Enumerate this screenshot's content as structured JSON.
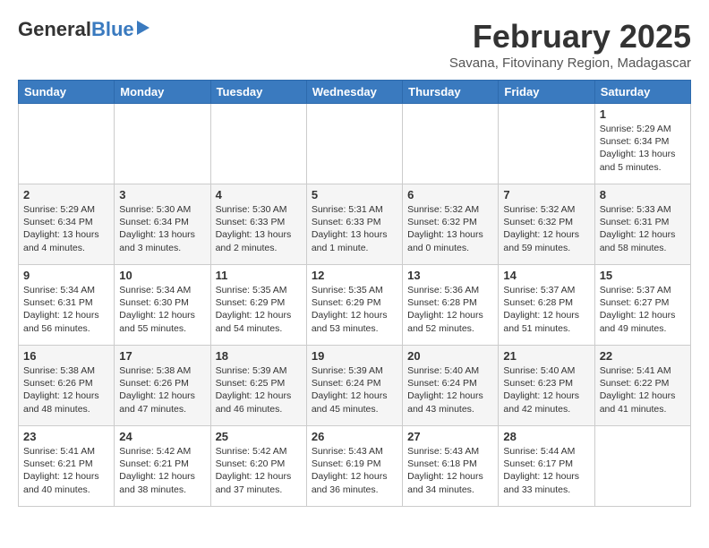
{
  "header": {
    "logo_general": "General",
    "logo_blue": "Blue",
    "month_title": "February 2025",
    "subtitle": "Savana, Fitovinany Region, Madagascar"
  },
  "weekdays": [
    "Sunday",
    "Monday",
    "Tuesday",
    "Wednesday",
    "Thursday",
    "Friday",
    "Saturday"
  ],
  "weeks": [
    [
      {
        "day": "",
        "info": ""
      },
      {
        "day": "",
        "info": ""
      },
      {
        "day": "",
        "info": ""
      },
      {
        "day": "",
        "info": ""
      },
      {
        "day": "",
        "info": ""
      },
      {
        "day": "",
        "info": ""
      },
      {
        "day": "1",
        "info": "Sunrise: 5:29 AM\nSunset: 6:34 PM\nDaylight: 13 hours\nand 5 minutes."
      }
    ],
    [
      {
        "day": "2",
        "info": "Sunrise: 5:29 AM\nSunset: 6:34 PM\nDaylight: 13 hours\nand 4 minutes."
      },
      {
        "day": "3",
        "info": "Sunrise: 5:30 AM\nSunset: 6:34 PM\nDaylight: 13 hours\nand 3 minutes."
      },
      {
        "day": "4",
        "info": "Sunrise: 5:30 AM\nSunset: 6:33 PM\nDaylight: 13 hours\nand 2 minutes."
      },
      {
        "day": "5",
        "info": "Sunrise: 5:31 AM\nSunset: 6:33 PM\nDaylight: 13 hours\nand 1 minute."
      },
      {
        "day": "6",
        "info": "Sunrise: 5:32 AM\nSunset: 6:32 PM\nDaylight: 13 hours\nand 0 minutes."
      },
      {
        "day": "7",
        "info": "Sunrise: 5:32 AM\nSunset: 6:32 PM\nDaylight: 12 hours\nand 59 minutes."
      },
      {
        "day": "8",
        "info": "Sunrise: 5:33 AM\nSunset: 6:31 PM\nDaylight: 12 hours\nand 58 minutes."
      }
    ],
    [
      {
        "day": "9",
        "info": "Sunrise: 5:34 AM\nSunset: 6:31 PM\nDaylight: 12 hours\nand 56 minutes."
      },
      {
        "day": "10",
        "info": "Sunrise: 5:34 AM\nSunset: 6:30 PM\nDaylight: 12 hours\nand 55 minutes."
      },
      {
        "day": "11",
        "info": "Sunrise: 5:35 AM\nSunset: 6:29 PM\nDaylight: 12 hours\nand 54 minutes."
      },
      {
        "day": "12",
        "info": "Sunrise: 5:35 AM\nSunset: 6:29 PM\nDaylight: 12 hours\nand 53 minutes."
      },
      {
        "day": "13",
        "info": "Sunrise: 5:36 AM\nSunset: 6:28 PM\nDaylight: 12 hours\nand 52 minutes."
      },
      {
        "day": "14",
        "info": "Sunrise: 5:37 AM\nSunset: 6:28 PM\nDaylight: 12 hours\nand 51 minutes."
      },
      {
        "day": "15",
        "info": "Sunrise: 5:37 AM\nSunset: 6:27 PM\nDaylight: 12 hours\nand 49 minutes."
      }
    ],
    [
      {
        "day": "16",
        "info": "Sunrise: 5:38 AM\nSunset: 6:26 PM\nDaylight: 12 hours\nand 48 minutes."
      },
      {
        "day": "17",
        "info": "Sunrise: 5:38 AM\nSunset: 6:26 PM\nDaylight: 12 hours\nand 47 minutes."
      },
      {
        "day": "18",
        "info": "Sunrise: 5:39 AM\nSunset: 6:25 PM\nDaylight: 12 hours\nand 46 minutes."
      },
      {
        "day": "19",
        "info": "Sunrise: 5:39 AM\nSunset: 6:24 PM\nDaylight: 12 hours\nand 45 minutes."
      },
      {
        "day": "20",
        "info": "Sunrise: 5:40 AM\nSunset: 6:24 PM\nDaylight: 12 hours\nand 43 minutes."
      },
      {
        "day": "21",
        "info": "Sunrise: 5:40 AM\nSunset: 6:23 PM\nDaylight: 12 hours\nand 42 minutes."
      },
      {
        "day": "22",
        "info": "Sunrise: 5:41 AM\nSunset: 6:22 PM\nDaylight: 12 hours\nand 41 minutes."
      }
    ],
    [
      {
        "day": "23",
        "info": "Sunrise: 5:41 AM\nSunset: 6:21 PM\nDaylight: 12 hours\nand 40 minutes."
      },
      {
        "day": "24",
        "info": "Sunrise: 5:42 AM\nSunset: 6:21 PM\nDaylight: 12 hours\nand 38 minutes."
      },
      {
        "day": "25",
        "info": "Sunrise: 5:42 AM\nSunset: 6:20 PM\nDaylight: 12 hours\nand 37 minutes."
      },
      {
        "day": "26",
        "info": "Sunrise: 5:43 AM\nSunset: 6:19 PM\nDaylight: 12 hours\nand 36 minutes."
      },
      {
        "day": "27",
        "info": "Sunrise: 5:43 AM\nSunset: 6:18 PM\nDaylight: 12 hours\nand 34 minutes."
      },
      {
        "day": "28",
        "info": "Sunrise: 5:44 AM\nSunset: 6:17 PM\nDaylight: 12 hours\nand 33 minutes."
      },
      {
        "day": "",
        "info": ""
      }
    ]
  ]
}
